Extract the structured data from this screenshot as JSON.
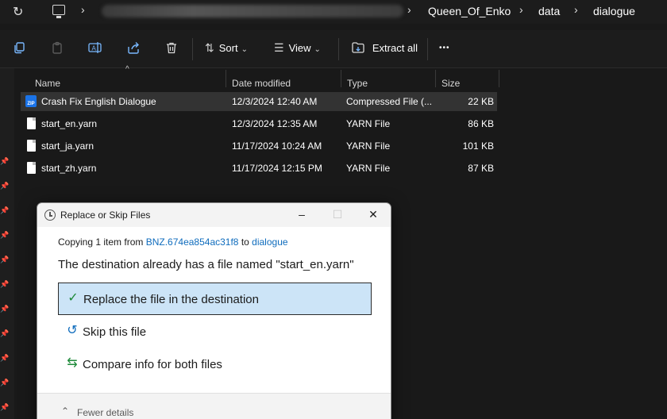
{
  "address_bar": {
    "breadcrumbs": [
      "Queen_Of_Enko",
      "data",
      "dialogue"
    ]
  },
  "toolbar": {
    "sort_label": "Sort",
    "view_label": "View",
    "extract_label": "Extract all",
    "more_label": "•••"
  },
  "columns": {
    "name": "Name",
    "date": "Date modified",
    "type": "Type",
    "size": "Size"
  },
  "files": [
    {
      "name": "Crash Fix English Dialogue",
      "date": "12/3/2024 12:40 AM",
      "type": "Compressed File (...",
      "size": "22 KB",
      "icon": "zip-icon"
    },
    {
      "name": "start_en.yarn",
      "date": "12/3/2024 12:35 AM",
      "type": "YARN File",
      "size": "86 KB",
      "icon": "file-icon"
    },
    {
      "name": "start_ja.yarn",
      "date": "11/17/2024 10:24 AM",
      "type": "YARN File",
      "size": "101 KB",
      "icon": "file-icon"
    },
    {
      "name": "start_zh.yarn",
      "date": "11/17/2024 12:15 PM",
      "type": "YARN File",
      "size": "87 KB",
      "icon": "file-icon"
    }
  ],
  "dialog": {
    "title": "Replace or Skip Files",
    "copying_prefix": "Copying 1 item from ",
    "source": "BNZ.674ea854ac31f8",
    "to_word": " to ",
    "target": "dialogue",
    "message": "The destination already has a file named \"start_en.yarn\"",
    "options": {
      "replace": "Replace the file in the destination",
      "skip": "Skip this file",
      "compare": "Compare info for both files"
    },
    "fewer_details": "Fewer details"
  }
}
